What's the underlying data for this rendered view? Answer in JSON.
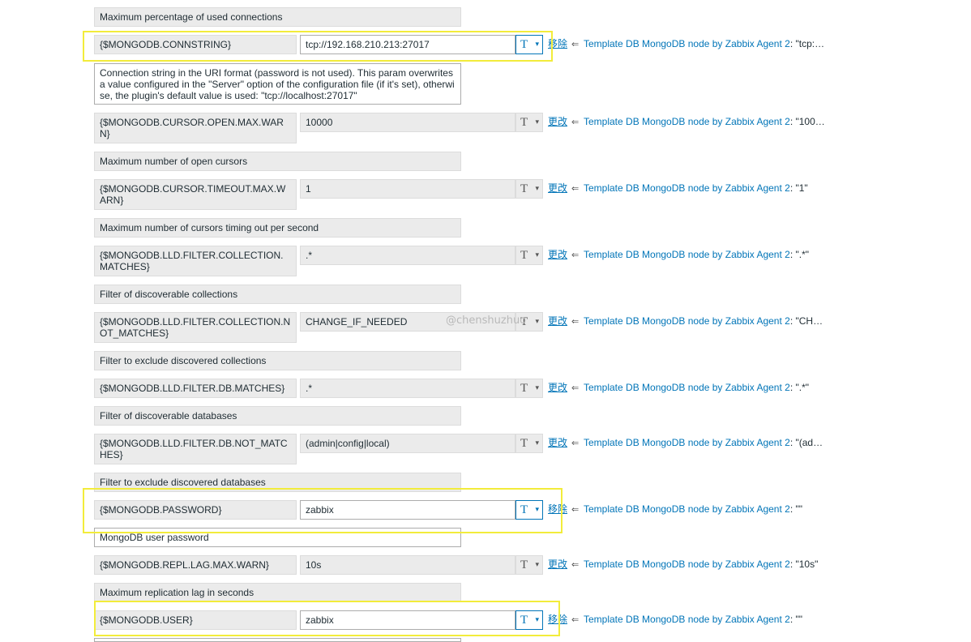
{
  "row0": {
    "desc": "Maximum percentage of used connections"
  },
  "row1": {
    "macro": "{$MONGODB.CONNSTRING}",
    "value": "tcp://192.168.210.213:27017",
    "action": "移除",
    "tpl": "Template DB MongoDB node by Zabbix Agent 2",
    "inh": ": \"tcp:…",
    "desc": "Connection string in the URI format (password is not used). This param overwrites a value configured in the \"Server\" option of the configuration file (if it's set), otherwise, the plugin's default value is used: \"tcp://localhost:27017\""
  },
  "row2": {
    "macro": "{$MONGODB.CURSOR.OPEN.MAX.WARN}",
    "value": "10000",
    "action": "更改",
    "tpl": "Template DB MongoDB node by Zabbix Agent 2",
    "inh": ": \"100…",
    "desc": "Maximum number of open cursors"
  },
  "row3": {
    "macro": "{$MONGODB.CURSOR.TIMEOUT.MAX.WARN}",
    "value": "1",
    "action": "更改",
    "tpl": "Template DB MongoDB node by Zabbix Agent 2",
    "inh": ": \"1\"",
    "desc": "Maximum number of cursors timing out per second"
  },
  "row4": {
    "macro": "{$MONGODB.LLD.FILTER.COLLECTION.MATCHES}",
    "value": ".*",
    "action": "更改",
    "tpl": "Template DB MongoDB node by Zabbix Agent 2",
    "inh": ": \".*\"",
    "desc": "Filter of discoverable collections"
  },
  "row5": {
    "macro": "{$MONGODB.LLD.FILTER.COLLECTION.NOT_MATCHES}",
    "value": "CHANGE_IF_NEEDED",
    "action": "更改",
    "tpl": "Template DB MongoDB node by Zabbix Agent 2",
    "inh": ": \"CH…",
    "desc": "Filter to exclude discovered collections"
  },
  "row6": {
    "macro": "{$MONGODB.LLD.FILTER.DB.MATCHES}",
    "value": ".*",
    "action": "更改",
    "tpl": "Template DB MongoDB node by Zabbix Agent 2",
    "inh": ": \".*\"",
    "desc": "Filter of discoverable databases"
  },
  "row7": {
    "macro": "{$MONGODB.LLD.FILTER.DB.NOT_MATCHES}",
    "value": "(admin|config|local)",
    "action": "更改",
    "tpl": "Template DB MongoDB node by Zabbix Agent 2",
    "inh": ": \"(ad…",
    "desc": "Filter to exclude discovered databases"
  },
  "row8": {
    "macro": "{$MONGODB.PASSWORD}",
    "value": "zabbix",
    "action": "移除",
    "tpl": "Template DB MongoDB node by Zabbix Agent 2",
    "inh": ": \"\"",
    "desc": "MongoDB user password"
  },
  "row9": {
    "macro": "{$MONGODB.REPL.LAG.MAX.WARN}",
    "value": "10s",
    "action": "更改",
    "tpl": "Template DB MongoDB node by Zabbix Agent 2",
    "inh": ": \"10s\"",
    "desc": "Maximum replication lag in seconds"
  },
  "row10": {
    "macro": "{$MONGODB.USER}",
    "value": "zabbix",
    "action": "移除",
    "tpl": "Template DB MongoDB node by Zabbix Agent 2",
    "inh": ": \"\""
  },
  "type_icon": "T",
  "chevron_icon": "chevron-down-icon",
  "arrow_icon": "⇐",
  "watermark": "@chenshuzhuo",
  "colors": {
    "link": "#0275b8",
    "highlight": "#f2ec3b",
    "readonly_bg": "#ebebeb"
  }
}
